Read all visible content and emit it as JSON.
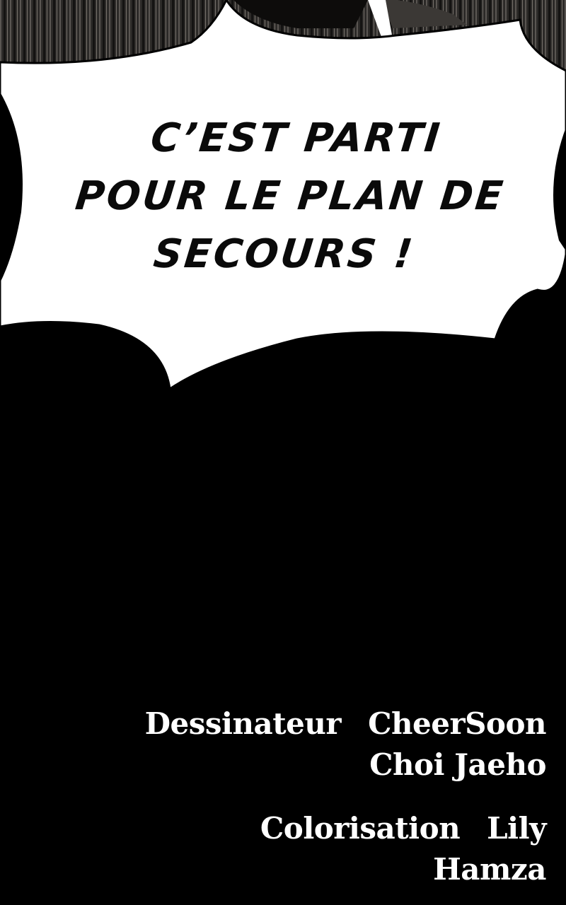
{
  "speech_bubble": {
    "lines": [
      "C’EST PARTI",
      "POUR LE PLAN DE",
      "SECOURS !"
    ]
  },
  "credits": {
    "artist": {
      "role": "Dessinateur",
      "names": [
        "CheerSoon",
        "Choi Jaeho"
      ]
    },
    "coloring": {
      "role": "Colorisation",
      "names": [
        "Lily",
        "Hamza"
      ]
    }
  }
}
